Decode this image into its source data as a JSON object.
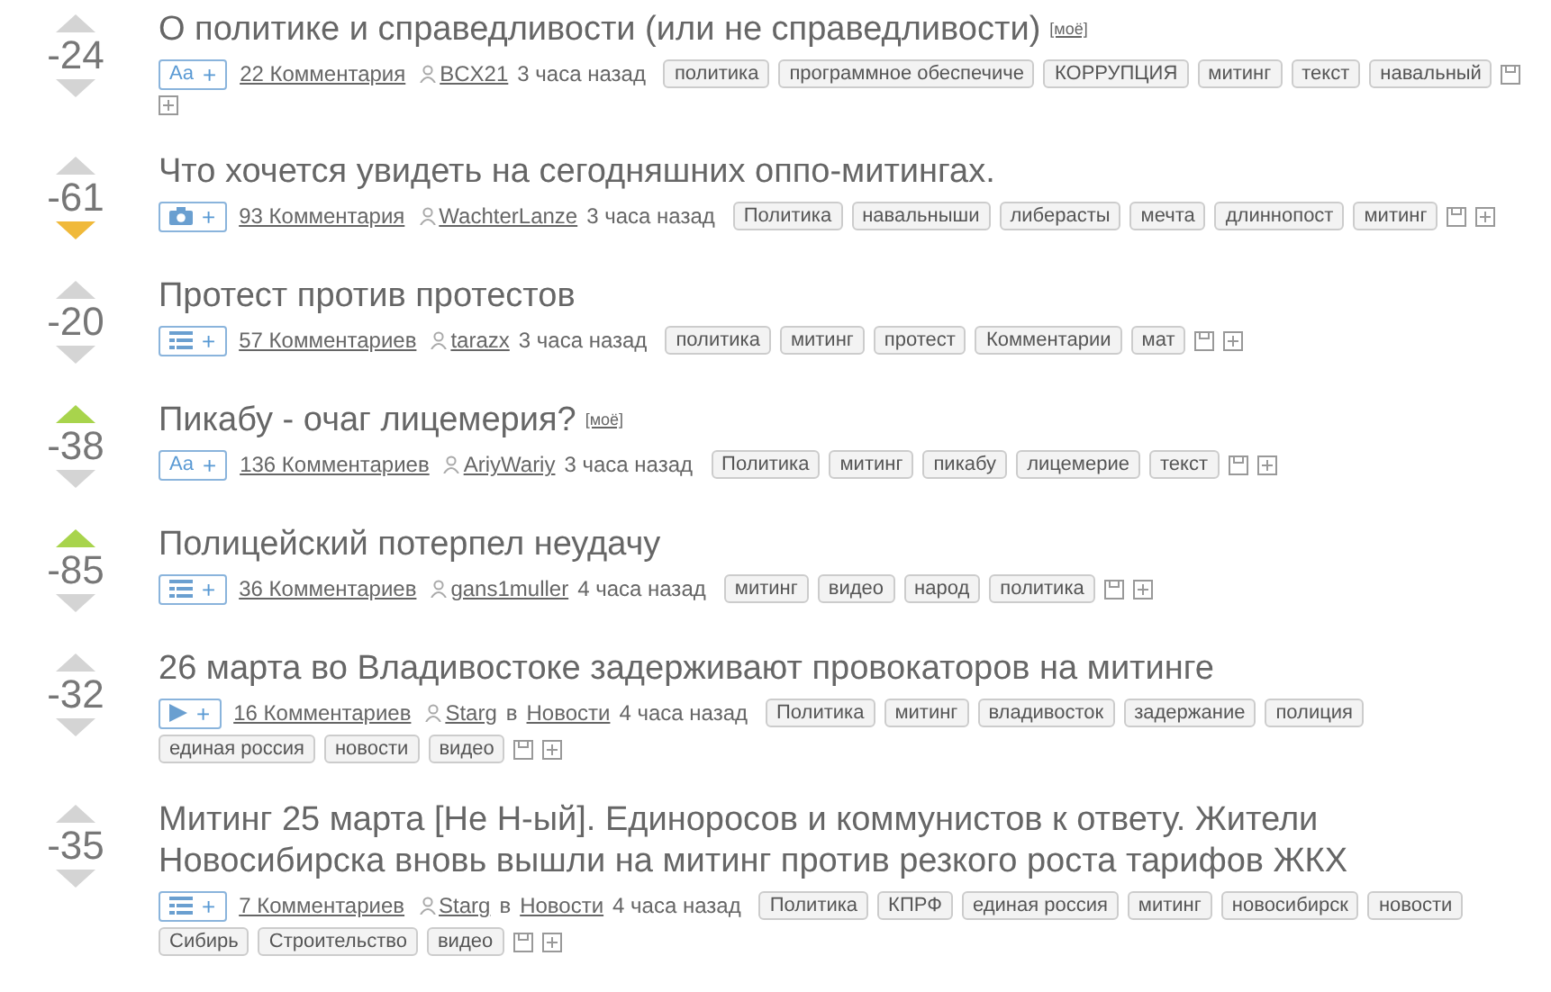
{
  "posts": [
    {
      "score": "-24",
      "voted_up": false,
      "voted_down": false,
      "title": "О политике и справедливости (или не справедливости)",
      "mine": "[моё]",
      "kind": "text",
      "type_label": "Aa",
      "plus": "+",
      "comments": "22 Комментария",
      "author": "BCX21",
      "time": "3 часа назад",
      "tags": [
        "политика",
        "программное обеспечиче",
        "КОРРУПЦИЯ",
        "митинг",
        "текст",
        "навальный"
      ]
    },
    {
      "score": "-61",
      "voted_up": false,
      "voted_down": true,
      "title": "Что хочется увидеть на сегодняшних оппо-митингах.",
      "kind": "photo",
      "plus": "+",
      "comments": "93 Комментария",
      "author": "WachterLanze",
      "time": "3 часа назад",
      "tags": [
        "Политика",
        "навальныши",
        "либерасты",
        "мечта",
        "длиннопост",
        "митинг"
      ]
    },
    {
      "score": "-20",
      "voted_up": false,
      "voted_down": false,
      "title": "Протест против протестов",
      "kind": "list",
      "plus": "+",
      "comments": "57 Комментариев",
      "author": "tarazx",
      "time": "3 часа назад",
      "tags": [
        "политика",
        "митинг",
        "протест",
        "Комментарии",
        "мат"
      ]
    },
    {
      "score": "-38",
      "voted_up": true,
      "voted_down": false,
      "title": "Пикабу - очаг лицемерия?",
      "mine": "[моё]",
      "kind": "text",
      "type_label": "Aa",
      "plus": "+",
      "comments": "136 Комментариев",
      "author": "AriyWariy",
      "time": "3 часа назад",
      "tags": [
        "Политика",
        "митинг",
        "пикабу",
        "лицемерие",
        "текст"
      ]
    },
    {
      "score": "-85",
      "voted_up": true,
      "voted_down": false,
      "title": "Полицейский потерпел неудачу",
      "kind": "list",
      "plus": "+",
      "comments": "36 Комментариев",
      "author": "gans1muller",
      "time": "4 часа назад",
      "tags": [
        "митинг",
        "видео",
        "народ",
        "политика"
      ]
    },
    {
      "score": "-32",
      "voted_up": false,
      "voted_down": false,
      "title": "26 марта во Владивостоке задерживают провокаторов на митинге",
      "kind": "video",
      "plus": "+",
      "comments": "16 Комментариев",
      "author": "Starg",
      "in": "в",
      "community": "Новости",
      "time": "4 часа назад",
      "tags": [
        "Политика",
        "митинг",
        "владивосток",
        "задержание",
        "полиция",
        "единая россия",
        "новости",
        "видео"
      ]
    },
    {
      "score": "-35",
      "voted_up": false,
      "voted_down": false,
      "title": "Митинг 25 марта [Не Н-ый]. Единоросов и коммунистов к ответу. Жители Новосибирска вновь вышли на митинг против резкого роста тарифов ЖКХ",
      "kind": "list",
      "plus": "+",
      "comments": "7 Комментариев",
      "author": "Starg",
      "in": "в",
      "community": "Новости",
      "time": "4 часа назад",
      "tags": [
        "Политика",
        "КПРФ",
        "единая россия",
        "митинг",
        "новосибирск",
        "новости",
        "Сибирь",
        "Строительство",
        "видео"
      ]
    }
  ]
}
